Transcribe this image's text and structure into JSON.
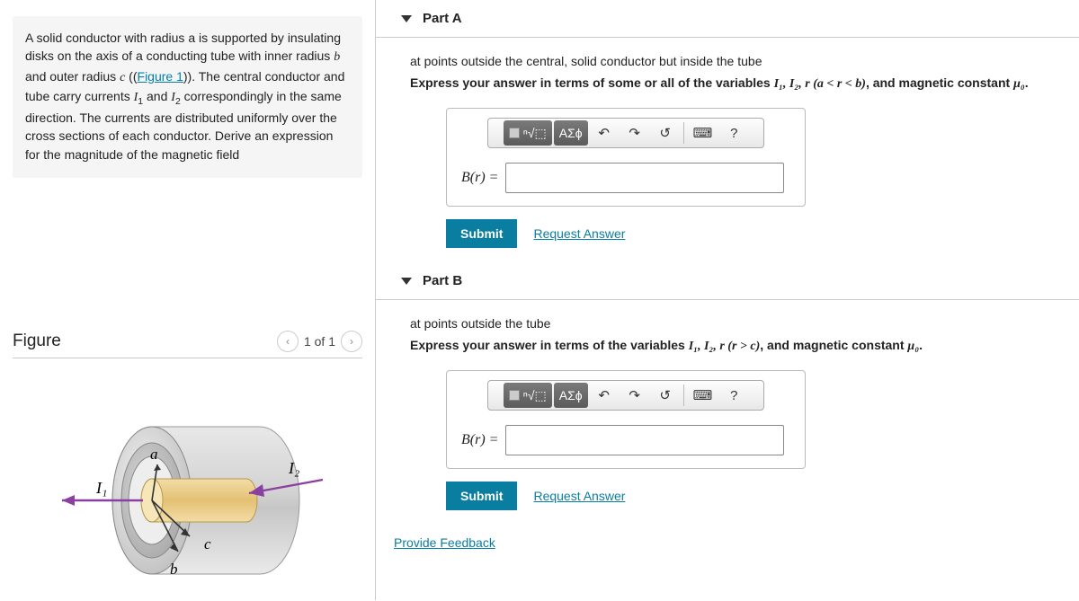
{
  "problem": {
    "text_pre": "A solid conductor with radius a is supported by insulating disks on the axis of a conducting tube with inner radius ",
    "var_b": "b",
    "text_mid1": " and outer radius ",
    "var_c": "c",
    "text_mid2": " ((",
    "figure_link": "Figure 1",
    "text_mid3": ")). The central conductor and tube carry currents ",
    "I1": "I",
    "I1_sub": "1",
    "and": " and ",
    "I2": "I",
    "I2_sub": "2",
    "text_end": " correspondingly in the same direction. The currents are distributed uniformly over the cross sections of each conductor. Derive an expression for the magnitude of the magnetic field"
  },
  "figure": {
    "heading": "Figure",
    "page": "1 of 1",
    "labels": {
      "I1": "I₁",
      "I2": "I₂",
      "a": "a",
      "b": "b",
      "c": "c"
    }
  },
  "parts": [
    {
      "title": "Part A",
      "prompt": "at points outside the central, solid conductor but inside the tube",
      "instruct_pre": "Express your answer in terms of some or all of the variables ",
      "instruct_vars": "I₁, I₂, r (a < r < b)",
      "instruct_post": ", and magnetic constant ",
      "mu": "μ₀",
      "dot": ".",
      "lhs": "B(r) =",
      "toolbar": {
        "templates": "⬚",
        "sqrt": "ⁿ√⬚",
        "greek": "ΑΣϕ",
        "undo": "↶",
        "redo": "↷",
        "reset": "↺",
        "keyboard": "⌨",
        "help": "?"
      },
      "submit": "Submit",
      "request": "Request Answer"
    },
    {
      "title": "Part B",
      "prompt": "at points outside the tube",
      "instruct_pre": "Express your answer in terms of the variables ",
      "instruct_vars": "I₁, I₂, r (r > c)",
      "instruct_post": ", and magnetic constant ",
      "mu": "μ₀",
      "dot": ".",
      "lhs": "B(r) =",
      "toolbar": {
        "templates": "⬚",
        "sqrt": "ⁿ√⬚",
        "greek": "ΑΣϕ",
        "undo": "↶",
        "redo": "↷",
        "reset": "↺",
        "keyboard": "⌨",
        "help": "?"
      },
      "submit": "Submit",
      "request": "Request Answer"
    }
  ],
  "feedback": "Provide Feedback"
}
